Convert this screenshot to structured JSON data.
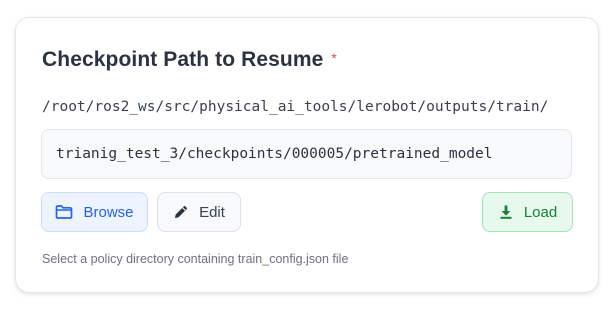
{
  "section": {
    "title": "Checkpoint Path to Resume",
    "required_marker": "*"
  },
  "path": {
    "base": "/root/ros2_ws/src/physical_ai_tools/lerobot/outputs/train/",
    "value": "trianig_test_3/checkpoints/000005/pretrained_model"
  },
  "buttons": {
    "browse_label": "Browse",
    "browse_icon": "folder-icon",
    "edit_label": "Edit",
    "edit_icon": "pencil-icon",
    "load_label": "Load",
    "load_icon": "download-icon"
  },
  "hint": "Select a policy directory containing train_config.json file",
  "colors": {
    "required": "#e5484d",
    "browse_accent": "#2563eb",
    "load_accent": "#16803c"
  }
}
